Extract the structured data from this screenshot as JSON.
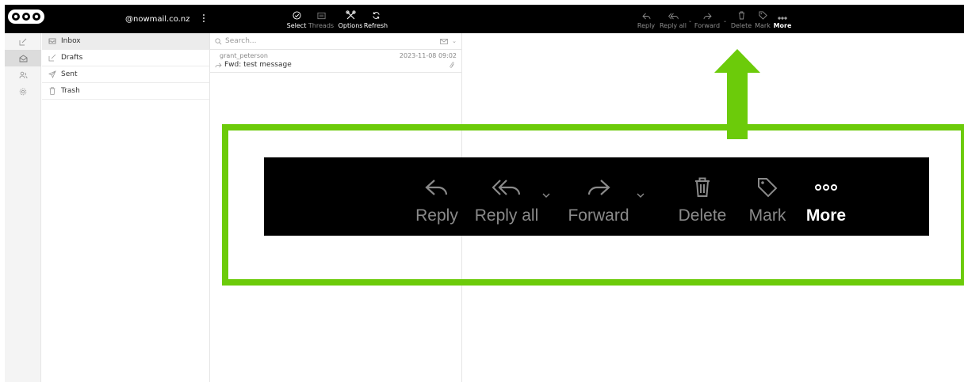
{
  "topbar": {
    "account": "@nowmail.co.nz",
    "left_actions": [
      {
        "id": "select",
        "label": "Select",
        "icon": "check-circle-icon",
        "state": "active"
      },
      {
        "id": "threads",
        "label": "Threads",
        "icon": "threads-icon",
        "state": "disabled"
      },
      {
        "id": "options",
        "label": "Options",
        "icon": "tools-icon",
        "state": "active"
      },
      {
        "id": "refresh",
        "label": "Refresh",
        "icon": "refresh-icon",
        "state": "active"
      }
    ],
    "right_actions": [
      {
        "id": "reply",
        "label": "Reply",
        "icon": "reply-icon",
        "state": "disabled"
      },
      {
        "id": "reply-all",
        "label": "Reply all",
        "icon": "reply-all-icon",
        "state": "disabled"
      },
      {
        "id": "forward",
        "label": "Forward",
        "icon": "forward-icon",
        "state": "disabled"
      },
      {
        "id": "delete",
        "label": "Delete",
        "icon": "trash-icon",
        "state": "disabled"
      },
      {
        "id": "mark",
        "label": "Mark",
        "icon": "tag-icon",
        "state": "disabled"
      },
      {
        "id": "more",
        "label": "More",
        "icon": "more-icon",
        "state": "active"
      }
    ]
  },
  "rail": {
    "items": [
      {
        "icon": "compose-icon",
        "active": false
      },
      {
        "icon": "mail-icon",
        "active": true
      },
      {
        "icon": "contacts-icon",
        "active": false
      },
      {
        "icon": "settings-icon",
        "active": false
      }
    ]
  },
  "folders": [
    {
      "label": "Inbox",
      "icon": "inbox-icon",
      "active": true
    },
    {
      "label": "Drafts",
      "icon": "drafts-icon",
      "active": false
    },
    {
      "label": "Sent",
      "icon": "sent-icon",
      "active": false
    },
    {
      "label": "Trash",
      "icon": "trash-icon",
      "active": false
    }
  ],
  "search": {
    "placeholder": "Search..."
  },
  "messages": [
    {
      "from": "grant_peterson",
      "date": "2023-11-08 09:02",
      "subject": "Fwd: test message",
      "forwarded": true,
      "attachment": true
    }
  ],
  "zoom_toolbar": {
    "reply": "Reply",
    "reply_all": "Reply all",
    "forward": "Forward",
    "delete": "Delete",
    "mark": "Mark",
    "more": "More"
  },
  "colors": {
    "highlight": "#6ccb0a",
    "toolbar_bg": "#000000",
    "disabled_text": "#8c8c8c"
  }
}
